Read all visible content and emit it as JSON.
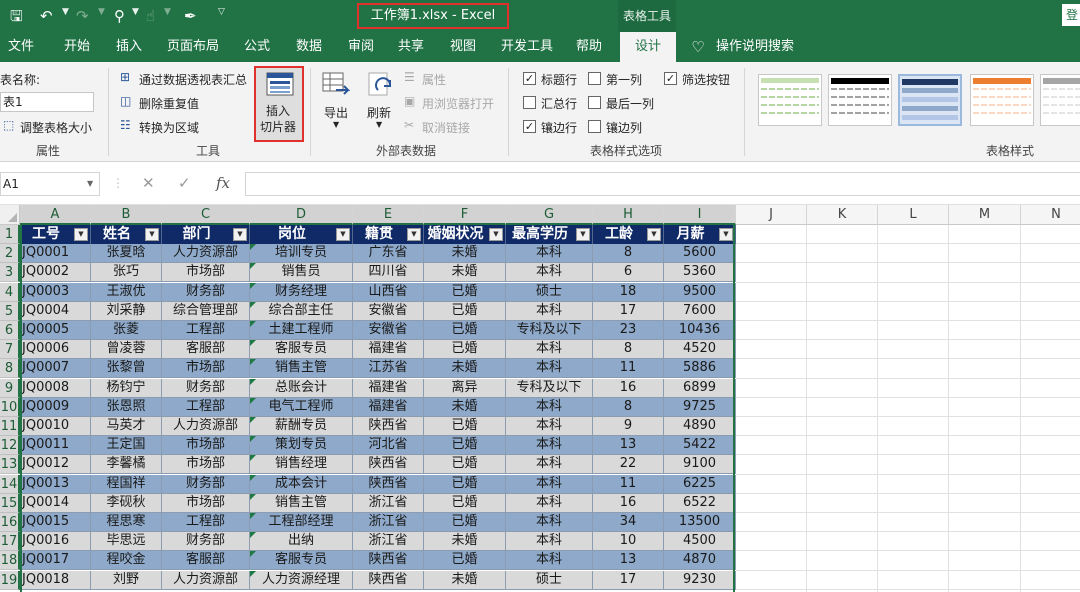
{
  "titlebar": {
    "title": "工作簿1.xlsx  -  Excel",
    "context_tab": "表格工具",
    "login": "登"
  },
  "tabs": [
    "文件",
    "开始",
    "插入",
    "页面布局",
    "公式",
    "数据",
    "审阅",
    "共享",
    "视图",
    "开发工具",
    "帮助",
    "设计"
  ],
  "tell_me": "操作说明搜索",
  "ribbon": {
    "properties": {
      "label": "属性",
      "table_name_label": "表名称:",
      "table_name_value": "表1",
      "resize": "调整表格大小"
    },
    "tools": {
      "label": "工具",
      "pivot": "通过数据透视表汇总",
      "remove_dup": "删除重复值",
      "to_range": "转换为区域",
      "slicer_line1": "插入",
      "slicer_line2": "切片器"
    },
    "external": {
      "label": "外部表数据",
      "export": "导出",
      "refresh": "刷新",
      "props": "属性",
      "open_browser": "用浏览器打开",
      "unlink": "取消链接"
    },
    "style_options": {
      "label": "表格样式选项",
      "header_row": "标题行",
      "first_col": "第一列",
      "filter_btn": "筛选按钮",
      "total_row": "汇总行",
      "last_col": "最后一列",
      "banded_rows": "镶边行",
      "banded_cols": "镶边列"
    },
    "styles": {
      "label": "表格样式"
    }
  },
  "formula": {
    "namebox": "A1",
    "fx": "fx"
  },
  "grid": {
    "columns": [
      "A",
      "B",
      "C",
      "D",
      "E",
      "F",
      "G",
      "H",
      "I",
      "J",
      "K",
      "L",
      "M",
      "N"
    ],
    "rows": [
      "1",
      "2",
      "3",
      "4",
      "5",
      "6",
      "7",
      "8",
      "9",
      "10",
      "11",
      "12",
      "13",
      "14",
      "15",
      "16",
      "17",
      "18",
      "19"
    ],
    "headers": [
      "工号",
      "姓名",
      "部门",
      "岗位",
      "籍贯",
      "婚姻状况",
      "最高学历",
      "工龄",
      "月薪"
    ],
    "data": [
      [
        "JQ0001",
        "张夏晗",
        "人力资源部",
        "培训专员",
        "广东省",
        "未婚",
        "本科",
        "8",
        "5600"
      ],
      [
        "JQ0002",
        "张巧",
        "市场部",
        "销售员",
        "四川省",
        "未婚",
        "本科",
        "6",
        "5360"
      ],
      [
        "JQ0003",
        "王淑优",
        "财务部",
        "财务经理",
        "山西省",
        "已婚",
        "硕士",
        "18",
        "9500"
      ],
      [
        "JQ0004",
        "刘采静",
        "综合管理部",
        "综合部主任",
        "安徽省",
        "已婚",
        "本科",
        "17",
        "7600"
      ],
      [
        "JQ0005",
        "张菱",
        "工程部",
        "土建工程师",
        "安徽省",
        "已婚",
        "专科及以下",
        "23",
        "10436"
      ],
      [
        "JQ0006",
        "曾凌蓉",
        "客服部",
        "客服专员",
        "福建省",
        "已婚",
        "本科",
        "8",
        "4520"
      ],
      [
        "JQ0007",
        "张黎曾",
        "市场部",
        "销售主管",
        "江苏省",
        "未婚",
        "本科",
        "11",
        "5886"
      ],
      [
        "JQ0008",
        "杨钧宁",
        "财务部",
        "总账会计",
        "福建省",
        "离异",
        "专科及以下",
        "16",
        "6899"
      ],
      [
        "JQ0009",
        "张恩照",
        "工程部",
        "电气工程师",
        "福建省",
        "未婚",
        "本科",
        "8",
        "9725"
      ],
      [
        "JQ0010",
        "马英才",
        "人力资源部",
        "薪酬专员",
        "陕西省",
        "已婚",
        "本科",
        "9",
        "4890"
      ],
      [
        "JQ0011",
        "王定国",
        "市场部",
        "策划专员",
        "河北省",
        "已婚",
        "本科",
        "13",
        "5422"
      ],
      [
        "JQ0012",
        "李馨橘",
        "市场部",
        "销售经理",
        "陕西省",
        "已婚",
        "本科",
        "22",
        "9100"
      ],
      [
        "JQ0013",
        "程国祥",
        "财务部",
        "成本会计",
        "陕西省",
        "已婚",
        "本科",
        "11",
        "6225"
      ],
      [
        "JQ0014",
        "李砚秋",
        "市场部",
        "销售主管",
        "浙江省",
        "已婚",
        "本科",
        "16",
        "6522"
      ],
      [
        "JQ0015",
        "程思寒",
        "工程部",
        "工程部经理",
        "浙江省",
        "已婚",
        "本科",
        "34",
        "13500"
      ],
      [
        "JQ0016",
        "毕思远",
        "财务部",
        "出纳",
        "浙江省",
        "未婚",
        "本科",
        "10",
        "4500"
      ],
      [
        "JQ0017",
        "程咬金",
        "客服部",
        "客服专员",
        "陕西省",
        "已婚",
        "本科",
        "13",
        "4870"
      ],
      [
        "JQ0018",
        "刘野",
        "人力资源部",
        "人力资源经理",
        "陕西省",
        "未婚",
        "硕士",
        "17",
        "9230"
      ]
    ]
  },
  "colors": {
    "excel_green": "#217346",
    "header_fill": "#0f2a66",
    "band_blue": "#8ea9c9",
    "band_gray": "#d9d9d9",
    "highlight_red": "#e0302b"
  }
}
